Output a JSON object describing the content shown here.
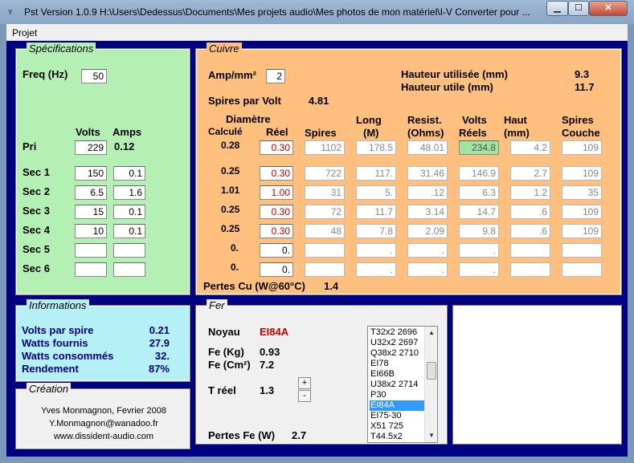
{
  "window": {
    "title": "Pst Version 1.0.9   H:\\Users\\Dedessus\\Documents\\Mes projets audio\\Mes photos de mon matériel\\I-V Converter pour ...",
    "icon": "transformer-icon",
    "minimize_label": "▁",
    "maximize_label": "☐",
    "close_label": "✕"
  },
  "menu": {
    "items": [
      "Projet"
    ]
  },
  "spec": {
    "title": "Spécifications",
    "freq_label": "Freq (Hz)",
    "freq_value": "50",
    "volts_header": "Volts",
    "amps_header": "Amps",
    "pri_label": "Pri",
    "pri_volts": "229",
    "pri_amps": "0.12",
    "secs": [
      {
        "label": "Sec 1",
        "volts": "150",
        "amps": "0.1"
      },
      {
        "label": "Sec 2",
        "volts": "6.5",
        "amps": "1.6"
      },
      {
        "label": "Sec 3",
        "volts": "15",
        "amps": "0.1"
      },
      {
        "label": "Sec 4",
        "volts": "10",
        "amps": "0.1"
      },
      {
        "label": "Sec 5",
        "volts": "",
        "amps": ""
      },
      {
        "label": "Sec 6",
        "volts": "",
        "amps": ""
      }
    ]
  },
  "cuivre": {
    "title": "Cuivre",
    "amp_label": "Amp/mm²",
    "amp_value": "2",
    "hauteur_utilisee_label": "Hauteur utilisée (mm)",
    "hauteur_utilisee_value": "9.3",
    "hauteur_utile_label": "Hauteur utile (mm)",
    "hauteur_utile_value": "11.7",
    "spires_par_volt_label": "Spires par Volt",
    "spires_par_volt_value": "4.81",
    "headers": {
      "diametre": "Diamètre",
      "calcule": "Calculé",
      "reel": "Réel",
      "spires": "Spires",
      "long": "Long",
      "long_unit": "(M)",
      "resist": "Resist.",
      "resist_unit": "(Ohms)",
      "volts": "Volts",
      "volts_sub": "Réels",
      "haut": "Haut",
      "haut_unit": "(mm)",
      "spires_couche": "Spires",
      "spires_couche_sub": "Couche"
    },
    "rows": [
      {
        "calc": "0.28",
        "reel": "0.30",
        "spires": "1102",
        "long": "178.5",
        "resist": "48.01",
        "volts": "234.8",
        "haut": "4.2",
        "couche": "109"
      },
      {
        "calc": "0.25",
        "reel": "0.30",
        "spires": "722",
        "long": "117.",
        "resist": "31.46",
        "volts": "146.9",
        "haut": "2.7",
        "couche": "109"
      },
      {
        "calc": "1.01",
        "reel": "1.00",
        "spires": "31",
        "long": "5.",
        "resist": ".12",
        "volts": "6.3",
        "haut": "1.2",
        "couche": "35"
      },
      {
        "calc": "0.25",
        "reel": "0.30",
        "spires": "72",
        "long": "11.7",
        "resist": "3.14",
        "volts": "14.7",
        "haut": ".6",
        "couche": "109"
      },
      {
        "calc": "0.25",
        "reel": "0.30",
        "spires": "48",
        "long": "7.8",
        "resist": "2.09",
        "volts": "9.8",
        "haut": ".6",
        "couche": "109"
      },
      {
        "calc": "0.",
        "reel": "0.",
        "spires": "",
        "long": ".",
        "resist": ".",
        "volts": ".",
        "haut": "",
        "couche": ""
      },
      {
        "calc": "0.",
        "reel": "0.",
        "spires": "",
        "long": ".",
        "resist": ".",
        "volts": ".",
        "haut": "",
        "couche": ""
      }
    ],
    "pertes_label": "Pertes Cu (W@60°C)",
    "pertes_value": "1.4"
  },
  "info": {
    "title": "Informations",
    "rows": [
      {
        "label": "Volts par spire",
        "value": "0.21"
      },
      {
        "label": "Watts fournis",
        "value": "27.9"
      },
      {
        "label": "Watts consommés",
        "value": "32."
      },
      {
        "label": "Rendement",
        "value": "87%"
      }
    ]
  },
  "fer": {
    "title": "Fer",
    "noyau_label": "Noyau",
    "noyau_value": "EI84A",
    "fe_kg_label": "Fe (Kg)",
    "fe_kg_value": "0.93",
    "fe_cm_label": "Fe (Cm²)",
    "fe_cm_value": "7.2",
    "treel_label": "T réel",
    "treel_value": "1.3",
    "spin_up": "+",
    "spin_down": "-",
    "pertes_label": "Pertes Fe (W)",
    "pertes_value": "2.7",
    "noyau_list": [
      "T32x2  2696",
      "U32x2  2697",
      "Q38x2  2710",
      "EI78",
      "EI66B",
      "U38x2  2714",
      "P30",
      "EI84A",
      "EI75-30",
      "X51  725",
      "T44.5x2"
    ],
    "selected": "EI84A"
  },
  "creation": {
    "title": "Création",
    "author": "Yves Monmagnon, Fevrier 2008",
    "email": "Y.Monmagnon@wanadoo.fr",
    "website": "www.dissident-audio.com"
  },
  "colors": {
    "client_bg": "#000080",
    "spec_bg": "#b4f0b4",
    "cuivre_bg": "#ffc07f",
    "info_bg": "#b4f0f5",
    "red_value": "#c00000",
    "volts_highlight": "#9fe49f"
  }
}
